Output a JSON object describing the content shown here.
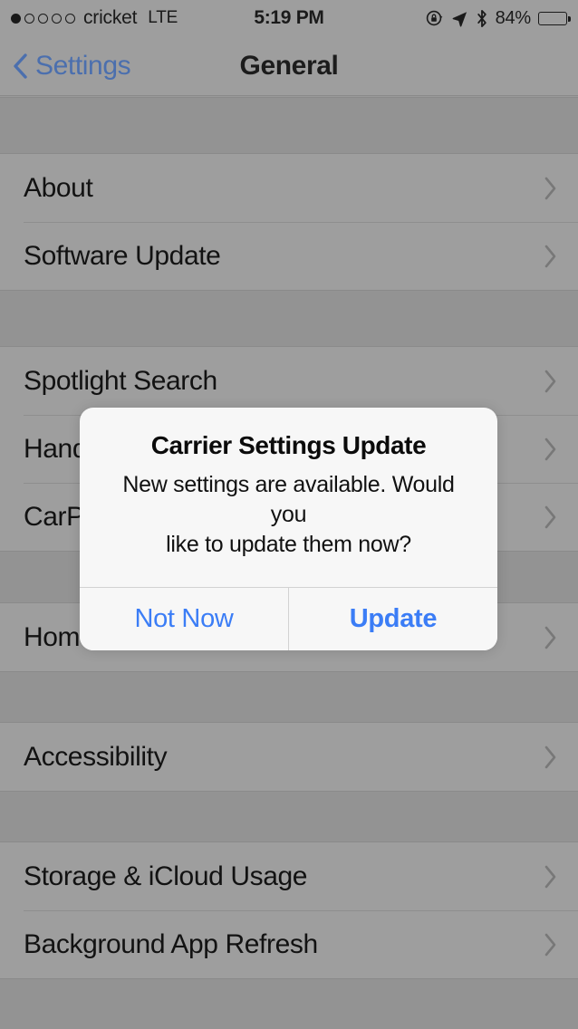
{
  "status_bar": {
    "signal_dots_total": 5,
    "signal_dots_filled": 1,
    "carrier": "cricket",
    "network_type": "LTE",
    "time": "5:19 PM",
    "battery_percent": "84%",
    "battery_level": 84,
    "icons": [
      "rotation-lock-icon",
      "location-arrow-icon",
      "bluetooth-icon"
    ]
  },
  "nav_bar": {
    "back_label": "Settings",
    "title": "General"
  },
  "list": {
    "groups": [
      {
        "rows": [
          {
            "label": "About",
            "accessory": "chevron-right-icon"
          },
          {
            "label": "Software Update",
            "accessory": "chevron-right-icon"
          }
        ]
      },
      {
        "rows": [
          {
            "label": "Spotlight Search",
            "accessory": "chevron-right-icon"
          },
          {
            "label": "Handoff",
            "accessory": "chevron-right-icon"
          },
          {
            "label": "CarPlay",
            "accessory": "chevron-right-icon"
          }
        ]
      },
      {
        "rows": [
          {
            "label": "Home Button",
            "accessory": "chevron-right-icon"
          }
        ]
      },
      {
        "rows": [
          {
            "label": "Accessibility",
            "accessory": "chevron-right-icon"
          }
        ]
      },
      {
        "rows": [
          {
            "label": "Storage & iCloud Usage",
            "accessory": "chevron-right-icon"
          },
          {
            "label": "Background App Refresh",
            "accessory": "chevron-right-icon"
          }
        ]
      }
    ]
  },
  "alert": {
    "title": "Carrier Settings Update",
    "message": "New settings are available.  Would you\nlike to update them now?",
    "buttons": [
      {
        "label": "Not Now",
        "style": "cancel"
      },
      {
        "label": "Update",
        "style": "default"
      }
    ]
  },
  "colors": {
    "tint_blue": "#3b7df6",
    "nav_blue": "#4b6fae",
    "list_bg": "#9e9e9e",
    "gap_bg": "#939393",
    "alert_bg": "#f7f7f7",
    "separator": "#8e8e8e"
  }
}
